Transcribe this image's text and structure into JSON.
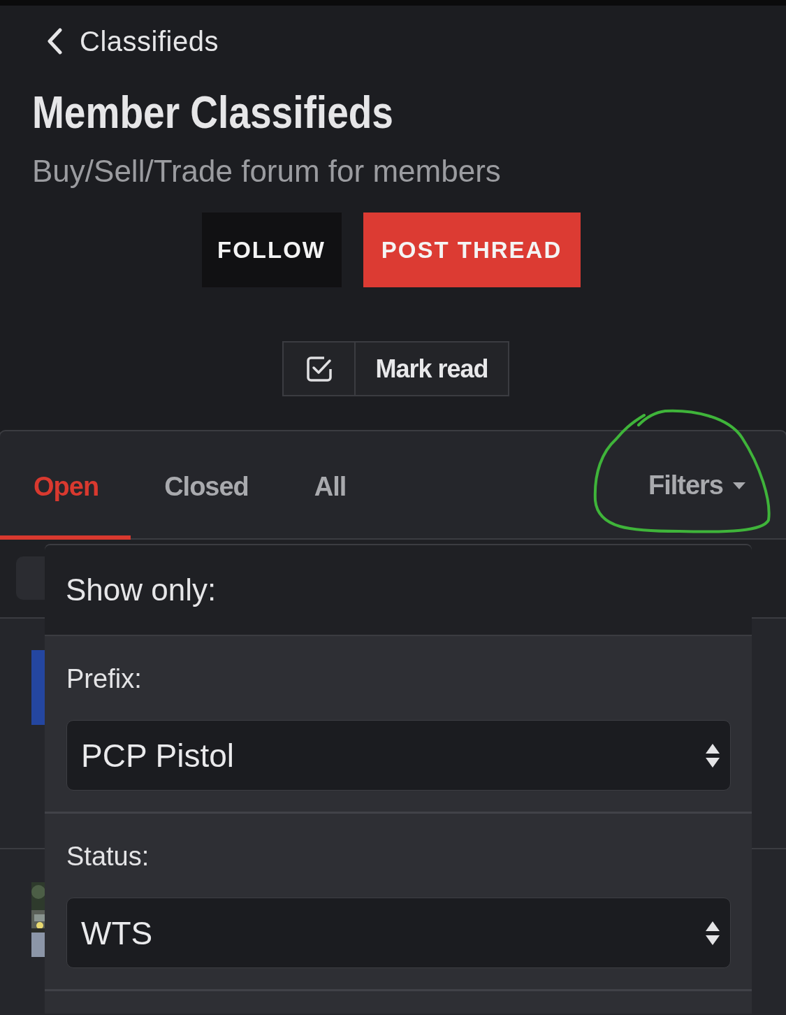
{
  "back_link": {
    "label": "Classifieds"
  },
  "title": "Member Classifieds",
  "subtitle": "Buy/Sell/Trade forum for members",
  "actions": [
    {
      "label": "FOLLOW",
      "kind": "secondary"
    },
    {
      "label": "POST THREAD",
      "kind": "primary"
    }
  ],
  "mark_read": {
    "label": "Mark read"
  },
  "tabs": [
    {
      "label": "Open",
      "selected": true
    },
    {
      "label": "Closed",
      "selected": false
    },
    {
      "label": "All",
      "selected": false
    }
  ],
  "filters_button": {
    "label": "Filters"
  },
  "threads": [
    {
      "kind": "swatch",
      "color": "#2446a0"
    },
    {
      "kind": "picture"
    }
  ],
  "filter_menu": {
    "heading": "Show only:",
    "fields": [
      {
        "label": "Prefix:",
        "value": "PCP Pistol"
      },
      {
        "label": "Status:",
        "value": "WTS"
      }
    ]
  }
}
